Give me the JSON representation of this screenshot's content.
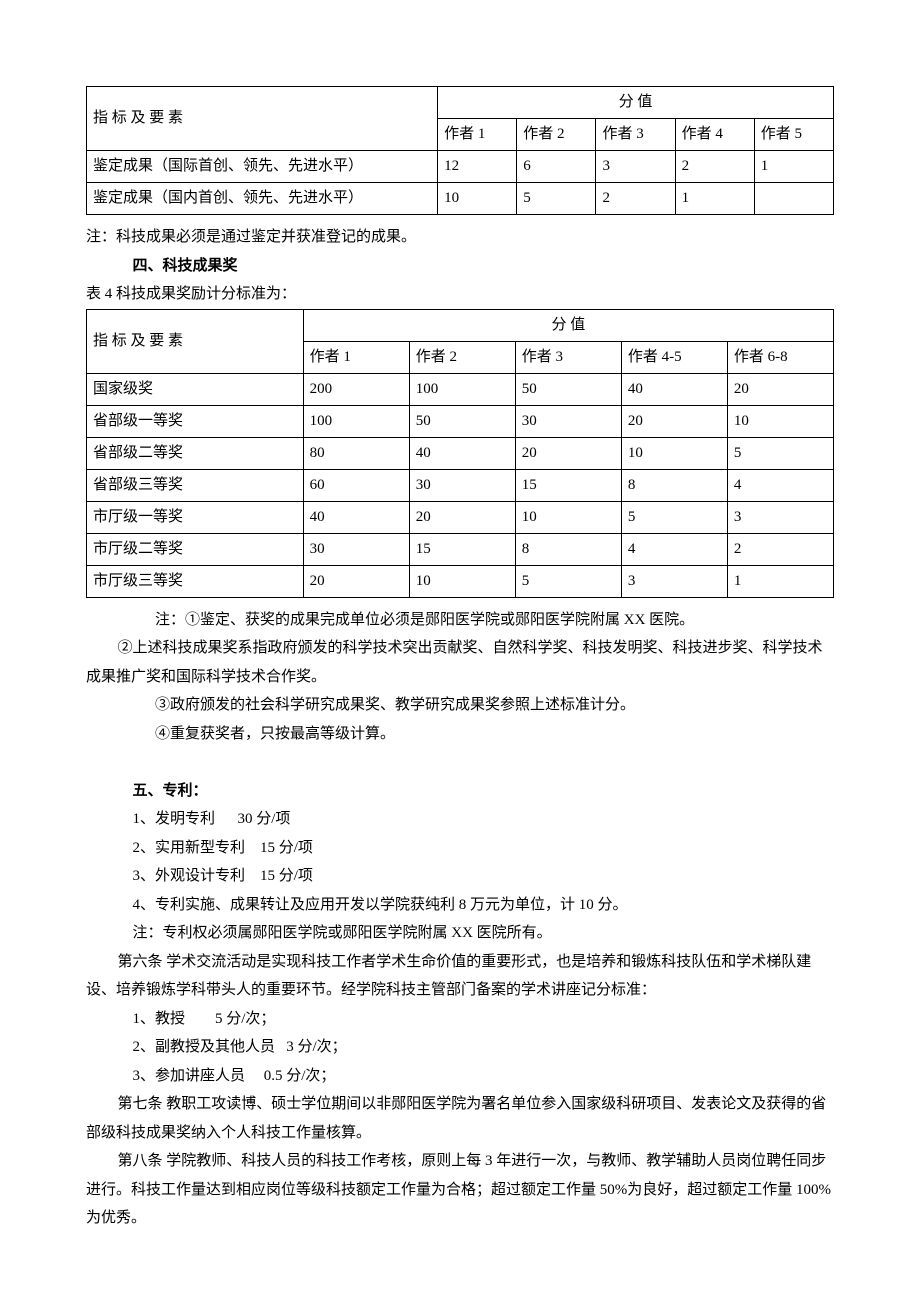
{
  "table1": {
    "rowLabel": "指 标 及 要 素",
    "topHeader": "分    值",
    "cols": [
      "作者 1",
      "作者 2",
      "作者 3",
      "作者 4",
      "作者 5"
    ],
    "rows": [
      {
        "label": "鉴定成果（国际首创、领先、先进水平）",
        "v": [
          "12",
          "6",
          "3",
          "2",
          "1"
        ]
      },
      {
        "label": "鉴定成果（国内首创、领先、先进水平）",
        "v": [
          "10",
          "5",
          "2",
          "1",
          ""
        ]
      }
    ]
  },
  "note1": "注：科技成果必须是通过鉴定并获准登记的成果。",
  "heading4": "四、科技成果奖",
  "table2caption": "表 4  科技成果奖励计分标准为：",
  "table2": {
    "rowLabel": "指 标 及 要 素",
    "topHeader": "分        值",
    "cols": [
      "作者 1",
      "作者 2",
      "作者 3",
      "作者 4-5",
      "作者 6-8"
    ],
    "rows": [
      {
        "label": "国家级奖",
        "v": [
          "200",
          "100",
          "50",
          "40",
          "20"
        ]
      },
      {
        "label": "省部级一等奖",
        "v": [
          "100",
          "50",
          "30",
          "20",
          "10"
        ]
      },
      {
        "label": "省部级二等奖",
        "v": [
          "80",
          "40",
          "20",
          "10",
          "5"
        ]
      },
      {
        "label": "省部级三等奖",
        "v": [
          "60",
          "30",
          "15",
          "8",
          "4"
        ]
      },
      {
        "label": "市厅级一等奖",
        "v": [
          "40",
          "20",
          "10",
          "5",
          "3"
        ]
      },
      {
        "label": "市厅级二等奖",
        "v": [
          "30",
          "15",
          "8",
          "4",
          "2"
        ]
      },
      {
        "label": "市厅级三等奖",
        "v": [
          "20",
          "10",
          "5",
          "3",
          "1"
        ]
      }
    ]
  },
  "notes2": {
    "a": "注：①鉴定、获奖的成果完成单位必须是郧阳医学院或郧阳医学院附属 XX 医院。",
    "b": "②上述科技成果奖系指政府颁发的科学技术突出贡献奖、自然科学奖、科技发明奖、科技进步奖、科学技术成果推广奖和国际科学技术合作奖。",
    "c": "③政府颁发的社会科学研究成果奖、教学研究成果奖参照上述标准计分。",
    "d": "④重复获奖者，只按最高等级计算。"
  },
  "heading5": "五、专利：",
  "patents": {
    "p1": "1、发明专利      30 分/项",
    "p2": "2、实用新型专利    15 分/项",
    "p3": "3、外观设计专利    15 分/项",
    "p4": "4、专利实施、成果转让及应用开发以学院获纯利 8 万元为单位，计 10 分。",
    "note": "注：专利权必须属郧阳医学院或郧阳医学院附属 XX 医院所有。"
  },
  "art6": "第六条  学术交流活动是实现科技工作者学术生命价值的重要形式，也是培养和锻炼科技队伍和学术梯队建设、培养锻炼学科带头人的重要环节。经学院科技主管部门备案的学术讲座记分标准：",
  "lectures": {
    "l1": "1、教授        5 分/次；",
    "l2": "2、副教授及其他人员   3 分/次；",
    "l3": "3、参加讲座人员     0.5 分/次；"
  },
  "art7": "第七条  教职工攻读博、硕士学位期间以非郧阳医学院为署名单位参入国家级科研项目、发表论文及获得的省部级科技成果奖纳入个人科技工作量核算。",
  "art8": "第八条  学院教师、科技人员的科技工作考核，原则上每 3 年进行一次，与教师、教学辅助人员岗位聘任同步进行。科技工作量达到相应岗位等级科技额定工作量为合格；超过额定工作量 50%为良好，超过额定工作量 100%为优秀。",
  "chart_data": [
    {
      "type": "table",
      "title": "鉴定成果计分",
      "columns": [
        "指标及要素",
        "作者1",
        "作者2",
        "作者3",
        "作者4",
        "作者5"
      ],
      "rows": [
        [
          "鉴定成果（国际首创、领先、先进水平）",
          12,
          6,
          3,
          2,
          1
        ],
        [
          "鉴定成果（国内首创、领先、先进水平）",
          10,
          5,
          2,
          1,
          null
        ]
      ]
    },
    {
      "type": "table",
      "title": "表4 科技成果奖励计分标准",
      "columns": [
        "指标及要素",
        "作者1",
        "作者2",
        "作者3",
        "作者4-5",
        "作者6-8"
      ],
      "rows": [
        [
          "国家级奖",
          200,
          100,
          50,
          40,
          20
        ],
        [
          "省部级一等奖",
          100,
          50,
          30,
          20,
          10
        ],
        [
          "省部级二等奖",
          80,
          40,
          20,
          10,
          5
        ],
        [
          "省部级三等奖",
          60,
          30,
          15,
          8,
          4
        ],
        [
          "市厅级一等奖",
          40,
          20,
          10,
          5,
          3
        ],
        [
          "市厅级二等奖",
          30,
          15,
          8,
          4,
          2
        ],
        [
          "市厅级三等奖",
          20,
          10,
          5,
          3,
          1
        ]
      ]
    }
  ]
}
